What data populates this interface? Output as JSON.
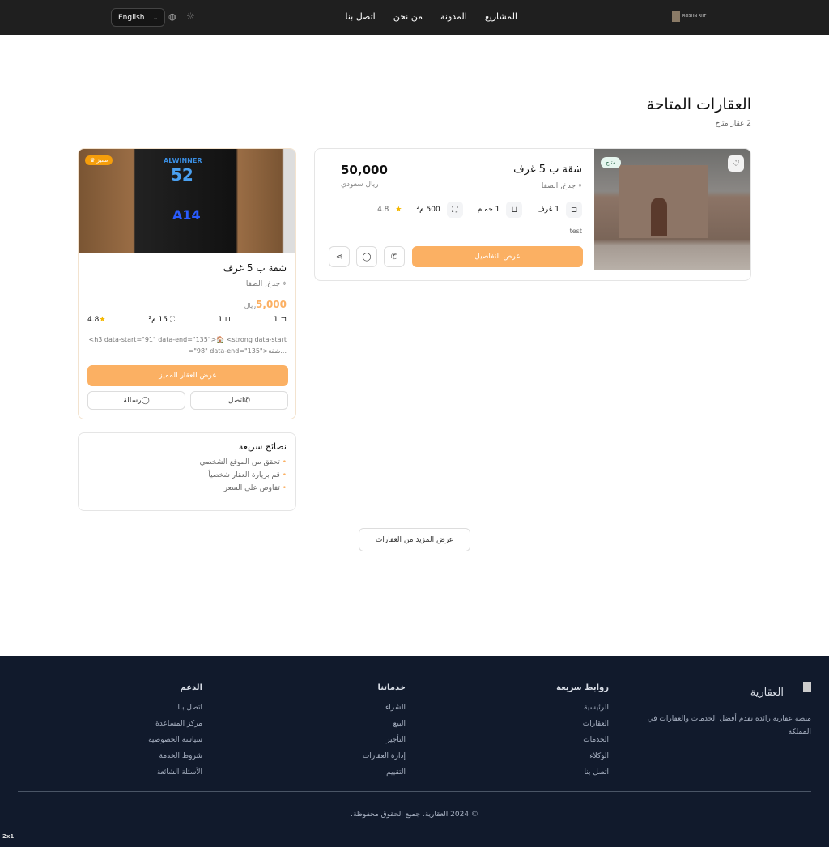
{
  "header": {
    "logo_text": "ROSHN RIIT",
    "nav": [
      "المشاريع",
      "المدونة",
      "من نحن",
      "اتصل بنا"
    ],
    "language": "English"
  },
  "page": {
    "title": "العقارات المتاحة",
    "count": "2 عقار متاح"
  },
  "listing": {
    "badge": "متاح",
    "title": "شقة ب 5 غرف",
    "location": "جدخ, الصفا",
    "price": "50,000",
    "currency": "ريال سعودي",
    "rooms": "1 غرف",
    "baths": "1 حمام",
    "area": "500 م²",
    "rating": "4.8",
    "description": "test",
    "details_button": "عرض التفاصيل"
  },
  "featured": {
    "badge": "مميز",
    "title": "شقة ب 5 غرف",
    "location": "جدخ, الصفا",
    "price": "5,000",
    "currency": "ريال",
    "rooms": "1",
    "baths": "1",
    "area": "15 م²",
    "rating": "4.8",
    "description": "<h3 data-start=\"91\" data-end=\"135\">🏠 <strong data-start=\"98\" data-end=\"135\">شقة...",
    "view_button": "عرض العقار المميز",
    "call_button": "اتصل",
    "message_button": "رسالة",
    "image_texts": [
      "ALWINNER",
      "52",
      "A14"
    ]
  },
  "tips": {
    "title": "نصائح سريعة",
    "items": [
      "تحقق من الموقع الشخصي",
      "قم بزيارة العقار شخصياً",
      "تفاوض على السعر"
    ]
  },
  "more_button": "عرض المزيد من العقارات",
  "footer": {
    "brand": "العقارية",
    "about": "منصة عقارية رائدة تقدم أفضل الخدمات والعقارات في المملكة",
    "quick_links": {
      "title": "روابط سريعة",
      "items": [
        "الرئيسية",
        "العقارات",
        "الخدمات",
        "الوكلاء",
        "اتصل بنا"
      ]
    },
    "services": {
      "title": "خدماتنا",
      "items": [
        "الشراء",
        "البيع",
        "التأجير",
        "إدارة العقارات",
        "التقييم"
      ]
    },
    "support": {
      "title": "الدعم",
      "items": [
        "اتصل بنا",
        "مركز المساعدة",
        "سياسة الخصوصية",
        "شروط الخدمة",
        "الأسئلة الشائعة"
      ]
    },
    "copyright": "© 2024 العقارية. جميع الحقوق محفوظة."
  },
  "corner_badge": "2x1",
  "colors": {
    "accent": "#fbb063",
    "header": "#1f1f1f",
    "footer": "#111a2c"
  }
}
